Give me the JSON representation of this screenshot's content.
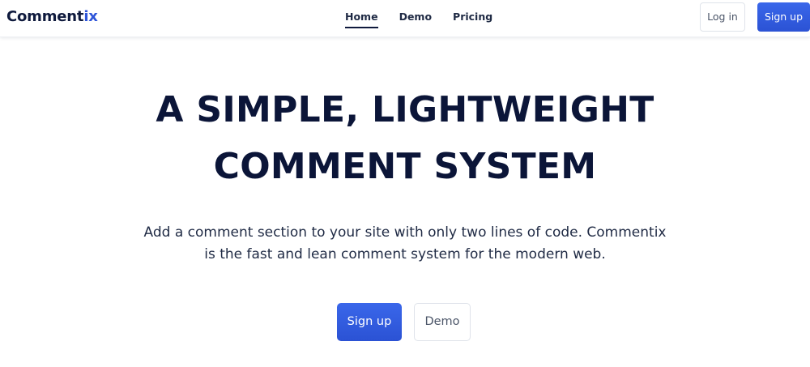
{
  "navbar": {
    "logo": {
      "main": "Comment",
      "accent": "ix"
    },
    "links": [
      {
        "label": "Home",
        "active": true
      },
      {
        "label": "Demo",
        "active": false
      },
      {
        "label": "Pricing",
        "active": false
      }
    ],
    "login_label": "Log in",
    "signup_label": "Sign up"
  },
  "hero": {
    "title_lines": [
      "A SIMPLE, LIGHTWEIGHT",
      "COMMENT SYSTEM"
    ],
    "subtitle_lines": [
      "Add a comment section to your site with only two lines of code. Commentix",
      "is the fast and lean comment system for the modern web."
    ],
    "primary_button": "Sign up",
    "secondary_button": "Demo"
  },
  "colors": {
    "brand_primary": "#2e55d9",
    "text_dark": "#0b1538",
    "text_muted": "#4b5568",
    "border": "#dfe3ea"
  }
}
